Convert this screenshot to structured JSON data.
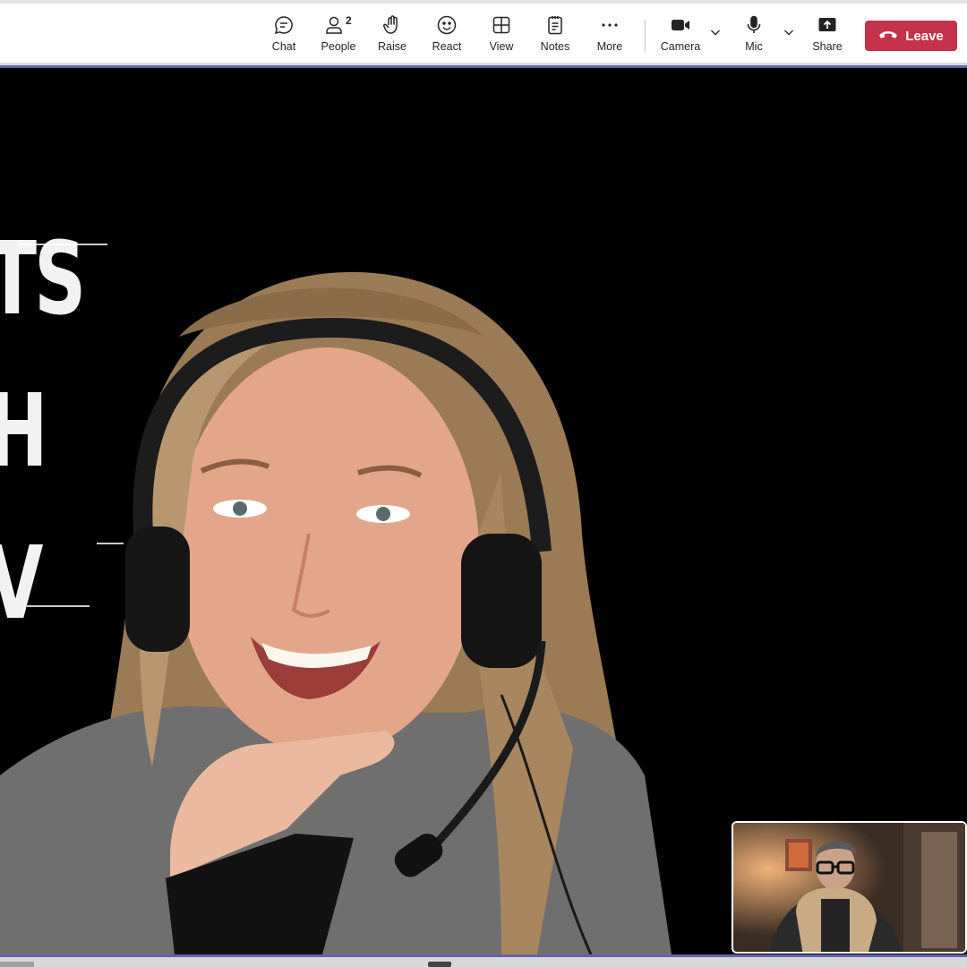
{
  "toolbar": {
    "chat_label": "Chat",
    "people_label": "People",
    "people_count": "2",
    "raise_label": "Raise",
    "react_label": "React",
    "view_label": "View",
    "notes_label": "Notes",
    "more_label": "More",
    "camera_label": "Camera",
    "mic_label": "Mic",
    "share_label": "Share",
    "leave_label": "Leave"
  },
  "icons": {
    "chat": "chat-bubble-icon",
    "people": "people-icon",
    "raise": "raise-hand-icon",
    "react": "smiley-icon",
    "view": "grid-view-icon",
    "notes": "notes-icon",
    "more": "more-dots-icon",
    "camera": "video-camera-icon",
    "mic": "microphone-icon",
    "share": "share-tray-icon",
    "leave": "phone-hangup-icon"
  },
  "stage": {
    "background_letters": [
      "TS",
      "H",
      "V"
    ]
  },
  "colors": {
    "leave_button": "#c4314b",
    "accent": "#6264a7",
    "stage_background": "#000000",
    "toolbar_background": "#ffffff"
  }
}
